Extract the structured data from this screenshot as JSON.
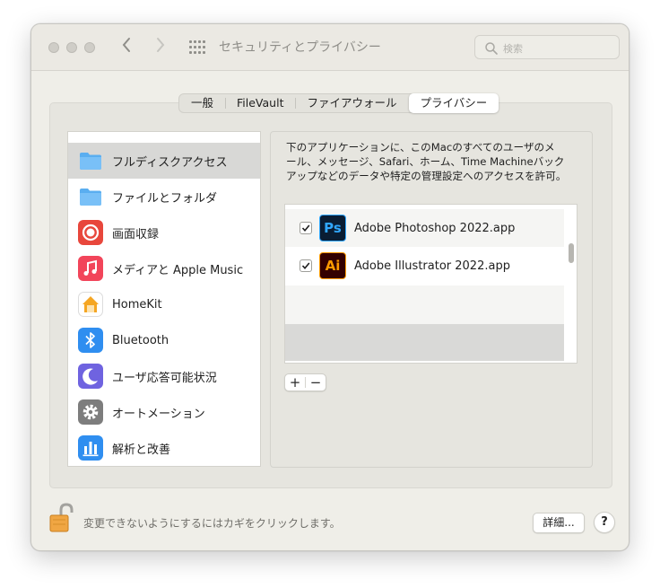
{
  "window": {
    "title": "セキュリティとプライバシー",
    "search_placeholder": "検索"
  },
  "tabs": [
    {
      "label": "一般",
      "active": false
    },
    {
      "label": "FileVault",
      "active": false
    },
    {
      "label": "ファイアウォール",
      "active": false
    },
    {
      "label": "プライバシー",
      "active": true
    }
  ],
  "sidebar": {
    "items": [
      {
        "label": "フルディスクアクセス",
        "icon": "folder-icon",
        "selected": true
      },
      {
        "label": "ファイルとフォルダ",
        "icon": "folder-icon",
        "selected": false
      },
      {
        "label": "画面収録",
        "icon": "screen-recording-icon",
        "selected": false
      },
      {
        "label": "メディアと Apple Music",
        "icon": "music-note-icon",
        "selected": false
      },
      {
        "label": "HomeKit",
        "icon": "home-icon",
        "selected": false
      },
      {
        "label": "Bluetooth",
        "icon": "bluetooth-icon",
        "selected": false
      },
      {
        "label": "ユーザ応答可能状況",
        "icon": "moon-icon",
        "selected": false
      },
      {
        "label": "オートメーション",
        "icon": "gear-icon",
        "selected": false
      },
      {
        "label": "解析と改善",
        "icon": "bar-chart-icon",
        "selected": false
      }
    ]
  },
  "description": {
    "line1": "下のアプリケーションに、このMacのすべてのユーザのメ",
    "line2": "ール、メッセージ、Safari、ホーム、Time Machineバック",
    "line3": "アップなどのデータや特定の管理設定へのアクセスを許可。"
  },
  "apps": [
    {
      "name": "Adobe Photoshop 2022.app",
      "icon_text": "Ps",
      "checked": true,
      "icon": "photoshop-icon"
    },
    {
      "name": "Adobe Illustrator 2022.app",
      "icon_text": "Ai",
      "checked": true,
      "icon": "illustrator-icon"
    }
  ],
  "buttons": {
    "add": "+",
    "remove": "−",
    "details": "詳細...",
    "help": "?"
  },
  "footer": {
    "lock_text": "変更できないようにするにはカギをクリックします。"
  },
  "colors": {
    "accent_blue": "#3b8cf5",
    "photoshop_bg": "#0a1d33",
    "photoshop_fg": "#31a8ff",
    "illustrator_bg": "#330000",
    "illustrator_fg": "#ff9a00"
  }
}
